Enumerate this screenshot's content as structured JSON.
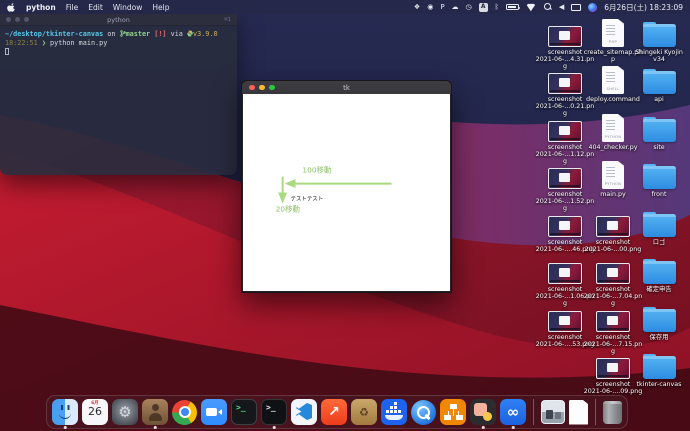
{
  "menu_bar": {
    "app_name": "python",
    "menus": [
      "File",
      "Edit",
      "Window",
      "Help"
    ],
    "status_icons": [
      {
        "name": "app-status-icon-1",
        "glyph": "❖"
      },
      {
        "name": "app-status-icon-2",
        "glyph": "◉"
      },
      {
        "name": "app-status-icon-p",
        "glyph": "P"
      },
      {
        "name": "icloud-status-icon",
        "glyph": "☁"
      },
      {
        "name": "clock-app-status-icon",
        "glyph": "◷"
      },
      {
        "name": "input-source-icon",
        "glyph": "A"
      },
      {
        "name": "bluetooth-icon",
        "glyph": "ᛒ"
      },
      {
        "name": "battery-icon",
        "glyph": ""
      },
      {
        "name": "wifi-icon",
        "glyph": ""
      },
      {
        "name": "spotlight-icon",
        "glyph": ""
      },
      {
        "name": "volume-icon",
        "glyph": "◀"
      },
      {
        "name": "display-icon",
        "glyph": ""
      },
      {
        "name": "siri-icon",
        "glyph": ""
      }
    ],
    "clock": "6月26日(土) 18:23:09"
  },
  "terminal": {
    "title": "python",
    "tab_hint": "⌘1",
    "prompt_line": {
      "path": "~/desktop/tkinter-canvas",
      "on_word": "on",
      "branch": "master",
      "dirty_flag": "[!]",
      "via_word": "via",
      "version": "v3.9.0"
    },
    "command_line": {
      "time": "18:22:51",
      "prompt_char": "❯",
      "command": "python main.py"
    }
  },
  "tk_window": {
    "title": "tk",
    "canvas": {
      "label_top": "100移動",
      "label_test": "テストテスト",
      "label_bottom": "20移動",
      "arrow_color": "#a9da80",
      "label_color": "#8cc063",
      "test_label_color": "#111111"
    }
  },
  "desktop": {
    "items": [
      {
        "type": "screenshot",
        "col": 1,
        "row": 1,
        "lines": [
          "screenshot",
          "2021-06-...4.31.png"
        ]
      },
      {
        "type": "file",
        "col": 2,
        "row": 1,
        "badge": "PHP",
        "lines": [
          "create_sitemap.ph",
          "p"
        ]
      },
      {
        "type": "folder",
        "col": 3,
        "row": 1,
        "lines": [
          "Shingeki Kyojin",
          "v34"
        ]
      },
      {
        "type": "screenshot",
        "col": 1,
        "row": 2,
        "lines": [
          "screenshot",
          "2021-06-...0.21.png"
        ]
      },
      {
        "type": "file",
        "col": 2,
        "row": 2,
        "badge": "SHELL",
        "lines": [
          "deploy.command"
        ]
      },
      {
        "type": "folder",
        "col": 3,
        "row": 2,
        "lines": [
          "api"
        ]
      },
      {
        "type": "screenshot",
        "col": 1,
        "row": 3,
        "lines": [
          "screenshot",
          "2021-06-...1.12.png"
        ]
      },
      {
        "type": "file",
        "col": 2,
        "row": 3,
        "badge": "PYTHON",
        "lines": [
          "404_checker.py"
        ]
      },
      {
        "type": "folder",
        "col": 3,
        "row": 3,
        "lines": [
          "site"
        ]
      },
      {
        "type": "screenshot",
        "col": 1,
        "row": 4,
        "lines": [
          "screenshot",
          "2021-06-...1.52.png"
        ]
      },
      {
        "type": "file",
        "col": 2,
        "row": 4,
        "badge": "PYTHON",
        "lines": [
          "main.py"
        ]
      },
      {
        "type": "folder",
        "col": 3,
        "row": 4,
        "lines": [
          "front"
        ]
      },
      {
        "type": "screenshot",
        "col": 1,
        "row": 5,
        "lines": [
          "screenshot",
          "2021-06-....46.png"
        ]
      },
      {
        "type": "screenshot",
        "col": 2,
        "row": 5,
        "lines": [
          "screenshot",
          "2021-06-...00.png"
        ]
      },
      {
        "type": "folder",
        "col": 3,
        "row": 5,
        "lines": [
          "ロゴ"
        ]
      },
      {
        "type": "screenshot",
        "col": 1,
        "row": 6,
        "lines": [
          "screenshot",
          "2021-06-...1.06.png"
        ]
      },
      {
        "type": "screenshot",
        "col": 2,
        "row": 6,
        "lines": [
          "screenshot",
          "2021-06-...7.04.png"
        ]
      },
      {
        "type": "folder",
        "col": 3,
        "row": 6,
        "lines": [
          "確定申告"
        ]
      },
      {
        "type": "screenshot",
        "col": 1,
        "row": 7,
        "lines": [
          "screenshot",
          "2021-06-....53.png"
        ]
      },
      {
        "type": "screenshot",
        "col": 2,
        "row": 7,
        "lines": [
          "screenshot",
          "2021-06-...7.15.png"
        ]
      },
      {
        "type": "folder",
        "col": 3,
        "row": 7,
        "lines": [
          "保存用"
        ]
      },
      {
        "type": "screenshot",
        "col": 2,
        "row": 8,
        "lines": [
          "screenshot",
          "2021-06-....09.png"
        ]
      },
      {
        "type": "folder",
        "col": 3,
        "row": 8,
        "lines": [
          "tkinter-canvas"
        ]
      }
    ]
  },
  "dock": {
    "calendar": {
      "month": "6月",
      "day": "26"
    },
    "items": [
      {
        "name": "finder-app",
        "type": "finder",
        "running": true
      },
      {
        "name": "calendar-app",
        "type": "calendar",
        "running": false
      },
      {
        "name": "system-preferences-app",
        "type": "settings",
        "running": false
      },
      {
        "name": "contacts-app",
        "type": "contacts",
        "running": true
      },
      {
        "name": "chrome-app",
        "type": "chrome",
        "running": false
      },
      {
        "name": "zoom-app",
        "type": "zoom",
        "running": false
      },
      {
        "name": "terminal-app",
        "type": "terminal",
        "running": false
      },
      {
        "name": "iterm-app",
        "type": "iterm",
        "running": true
      },
      {
        "name": "vscode-app",
        "type": "vscode",
        "running": false
      },
      {
        "name": "chart-app",
        "type": "chart",
        "running": false
      },
      {
        "name": "appcleaner-app",
        "type": "cleaner",
        "running": false
      },
      {
        "name": "docker-app",
        "type": "docker",
        "running": false
      },
      {
        "name": "quicktime-app",
        "type": "quicktime",
        "running": false
      },
      {
        "name": "diagrams-app",
        "type": "diagrams",
        "running": false
      },
      {
        "name": "screenshot-tool-app",
        "type": "shot",
        "running": true
      },
      {
        "name": "infinity-app",
        "type": "infinity",
        "running": true
      },
      {
        "name": "dock-separator",
        "type": "separator",
        "running": false
      },
      {
        "name": "minimized-window-thumbnail",
        "type": "photo",
        "running": false
      },
      {
        "name": "document-file",
        "type": "document",
        "running": false
      },
      {
        "name": "dock-separator",
        "type": "separator",
        "running": false
      },
      {
        "name": "trash",
        "type": "trash",
        "running": false
      }
    ]
  }
}
